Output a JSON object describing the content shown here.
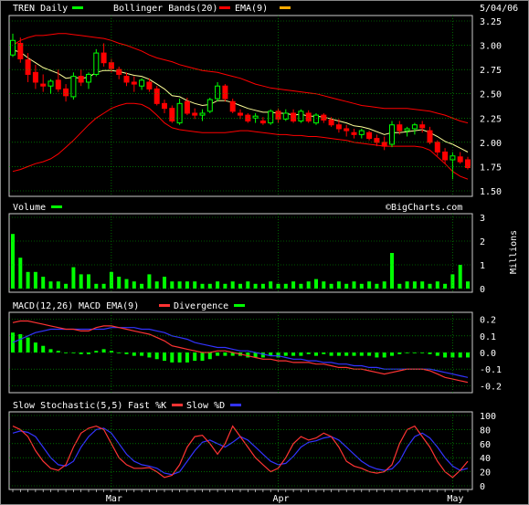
{
  "chart_data": {
    "type": "candlestick",
    "symbol_label": "TREN Daily",
    "date_label": "5/04/06",
    "watermark": "©BigCharts.com",
    "x_labels": [
      "Mar",
      "Apr",
      "May"
    ],
    "colors": {
      "up": "#00ff00",
      "down": "#ff0000",
      "ema": "#ffff99",
      "bollinger": "#ff0000",
      "grid": "#00aa00",
      "macd": "#ff3333",
      "signal": "#3333ff",
      "divergence": "#00ff00",
      "slow_k": "#ff3333",
      "slow_d": "#3333ff"
    },
    "price_panel": {
      "legend": [
        "TREN Daily",
        "Bollinger Bands(20)",
        "EMA(9)"
      ],
      "y_ticks": [
        "3.25",
        "3.00",
        "2.75",
        "2.50",
        "2.25",
        "2.00",
        "1.75",
        "1.50"
      ],
      "ylim": [
        1.5,
        3.25
      ],
      "candles": [
        [
          2.9,
          3.12,
          2.88,
          3.05
        ],
        [
          3.02,
          3.08,
          2.82,
          2.86
        ],
        [
          2.85,
          2.92,
          2.62,
          2.7
        ],
        [
          2.72,
          2.8,
          2.55,
          2.62
        ],
        [
          2.6,
          2.7,
          2.52,
          2.58
        ],
        [
          2.58,
          2.65,
          2.5,
          2.63
        ],
        [
          2.64,
          2.75,
          2.52,
          2.55
        ],
        [
          2.55,
          2.6,
          2.42,
          2.48
        ],
        [
          2.47,
          2.72,
          2.44,
          2.68
        ],
        [
          2.68,
          2.75,
          2.58,
          2.62
        ],
        [
          2.62,
          2.72,
          2.55,
          2.7
        ],
        [
          2.7,
          2.96,
          2.68,
          2.92
        ],
        [
          2.92,
          3.02,
          2.78,
          2.82
        ],
        [
          2.82,
          2.86,
          2.72,
          2.76
        ],
        [
          2.75,
          2.78,
          2.65,
          2.7
        ],
        [
          2.68,
          2.72,
          2.58,
          2.62
        ],
        [
          2.62,
          2.68,
          2.52,
          2.6
        ],
        [
          2.58,
          2.66,
          2.54,
          2.64
        ],
        [
          2.62,
          2.66,
          2.52,
          2.55
        ],
        [
          2.55,
          2.58,
          2.38,
          2.4
        ],
        [
          2.4,
          2.44,
          2.3,
          2.35
        ],
        [
          2.35,
          2.38,
          2.2,
          2.22
        ],
        [
          2.2,
          2.45,
          2.18,
          2.4
        ],
        [
          2.42,
          2.46,
          2.28,
          2.3
        ],
        [
          2.3,
          2.35,
          2.24,
          2.28
        ],
        [
          2.28,
          2.34,
          2.22,
          2.3
        ],
        [
          2.32,
          2.46,
          2.3,
          2.44
        ],
        [
          2.45,
          2.62,
          2.42,
          2.58
        ],
        [
          2.58,
          2.6,
          2.42,
          2.45
        ],
        [
          2.42,
          2.45,
          2.3,
          2.32
        ],
        [
          2.3,
          2.34,
          2.24,
          2.28
        ],
        [
          2.28,
          2.3,
          2.2,
          2.22
        ],
        [
          2.25,
          2.3,
          2.2,
          2.27
        ],
        [
          2.22,
          2.26,
          2.18,
          2.2
        ],
        [
          2.2,
          2.34,
          2.18,
          2.32
        ],
        [
          2.32,
          2.35,
          2.2,
          2.24
        ],
        [
          2.24,
          2.34,
          2.22,
          2.3
        ],
        [
          2.3,
          2.34,
          2.2,
          2.22
        ],
        [
          2.22,
          2.34,
          2.2,
          2.32
        ],
        [
          2.3,
          2.33,
          2.2,
          2.22
        ],
        [
          2.2,
          2.3,
          2.18,
          2.28
        ],
        [
          2.28,
          2.3,
          2.2,
          2.23
        ],
        [
          2.23,
          2.26,
          2.16,
          2.18
        ],
        [
          2.18,
          2.24,
          2.1,
          2.14
        ],
        [
          2.14,
          2.18,
          2.06,
          2.12
        ],
        [
          2.1,
          2.14,
          2.04,
          2.08
        ],
        [
          2.08,
          2.14,
          2.04,
          2.12
        ],
        [
          2.1,
          2.12,
          2.02,
          2.04
        ],
        [
          2.04,
          2.08,
          1.96,
          2.0
        ],
        [
          2.0,
          2.06,
          1.92,
          1.96
        ],
        [
          1.98,
          2.22,
          1.95,
          2.18
        ],
        [
          2.18,
          2.22,
          2.08,
          2.12
        ],
        [
          2.12,
          2.16,
          2.06,
          2.14
        ],
        [
          2.14,
          2.2,
          2.08,
          2.18
        ],
        [
          2.18,
          2.22,
          2.1,
          2.15
        ],
        [
          2.12,
          2.16,
          1.98,
          2.0
        ],
        [
          2.0,
          2.02,
          1.86,
          1.9
        ],
        [
          1.9,
          1.94,
          1.78,
          1.82
        ],
        [
          1.82,
          1.9,
          1.62,
          1.86
        ],
        [
          1.85,
          1.9,
          1.78,
          1.8
        ],
        [
          1.82,
          1.85,
          1.72,
          1.74
        ]
      ],
      "ema": [
        2.95,
        2.93,
        2.87,
        2.82,
        2.77,
        2.74,
        2.71,
        2.66,
        2.67,
        2.66,
        2.67,
        2.72,
        2.74,
        2.74,
        2.73,
        2.71,
        2.69,
        2.68,
        2.65,
        2.6,
        2.55,
        2.48,
        2.47,
        2.43,
        2.4,
        2.38,
        2.39,
        2.43,
        2.43,
        2.41,
        2.38,
        2.35,
        2.33,
        2.31,
        2.31,
        2.3,
        2.3,
        2.28,
        2.29,
        2.27,
        2.27,
        2.26,
        2.24,
        2.22,
        2.2,
        2.17,
        2.16,
        2.14,
        2.11,
        2.08,
        2.1,
        2.1,
        2.11,
        2.12,
        2.13,
        2.1,
        2.06,
        2.01,
        1.98,
        1.94,
        1.9
      ],
      "bb_upper": [
        3.0,
        3.05,
        3.08,
        3.1,
        3.1,
        3.11,
        3.12,
        3.12,
        3.11,
        3.1,
        3.09,
        3.08,
        3.07,
        3.05,
        3.02,
        3.0,
        2.97,
        2.94,
        2.9,
        2.87,
        2.85,
        2.83,
        2.8,
        2.78,
        2.76,
        2.74,
        2.73,
        2.72,
        2.7,
        2.68,
        2.66,
        2.63,
        2.6,
        2.58,
        2.56,
        2.55,
        2.54,
        2.53,
        2.52,
        2.51,
        2.5,
        2.48,
        2.46,
        2.44,
        2.42,
        2.4,
        2.38,
        2.37,
        2.36,
        2.35,
        2.35,
        2.35,
        2.35,
        2.34,
        2.33,
        2.32,
        2.3,
        2.28,
        2.25,
        2.22,
        2.2
      ],
      "bb_lower": [
        1.7,
        1.72,
        1.75,
        1.78,
        1.8,
        1.83,
        1.88,
        1.95,
        2.02,
        2.1,
        2.18,
        2.25,
        2.3,
        2.35,
        2.38,
        2.4,
        2.4,
        2.39,
        2.35,
        2.28,
        2.2,
        2.15,
        2.13,
        2.12,
        2.11,
        2.1,
        2.1,
        2.1,
        2.1,
        2.11,
        2.12,
        2.12,
        2.11,
        2.1,
        2.09,
        2.08,
        2.08,
        2.07,
        2.07,
        2.06,
        2.06,
        2.05,
        2.04,
        2.03,
        2.02,
        2.0,
        1.99,
        1.98,
        1.97,
        1.96,
        1.96,
        1.96,
        1.96,
        1.96,
        1.95,
        1.92,
        1.85,
        1.78,
        1.7,
        1.65,
        1.62
      ]
    },
    "volume_panel": {
      "legend": [
        "Volume"
      ],
      "y_ticks": [
        "3",
        "2",
        "1",
        "0"
      ],
      "ylim": [
        0,
        3
      ],
      "unit_label": "Millions",
      "values": [
        2.3,
        1.3,
        0.7,
        0.7,
        0.5,
        0.3,
        0.3,
        0.2,
        0.9,
        0.6,
        0.6,
        0.2,
        0.2,
        0.7,
        0.5,
        0.4,
        0.3,
        0.2,
        0.6,
        0.3,
        0.5,
        0.3,
        0.3,
        0.3,
        0.3,
        0.2,
        0.2,
        0.3,
        0.2,
        0.3,
        0.2,
        0.3,
        0.2,
        0.2,
        0.3,
        0.2,
        0.2,
        0.3,
        0.2,
        0.3,
        0.4,
        0.3,
        0.2,
        0.3,
        0.2,
        0.3,
        0.2,
        0.3,
        0.2,
        0.3,
        1.5,
        0.2,
        0.3,
        0.3,
        0.3,
        0.2,
        0.3,
        0.2,
        0.6,
        1.0,
        0.3
      ]
    },
    "macd_panel": {
      "legend": [
        "MACD(12,26)",
        "MACD EMA(9)",
        "Divergence"
      ],
      "y_ticks": [
        "0.2",
        "0.1",
        "0.0",
        "-0.1",
        "-0.2"
      ],
      "ylim": [
        -0.22,
        0.22
      ],
      "macd": [
        0.18,
        0.19,
        0.19,
        0.18,
        0.17,
        0.16,
        0.15,
        0.14,
        0.14,
        0.13,
        0.13,
        0.15,
        0.16,
        0.16,
        0.15,
        0.14,
        0.13,
        0.12,
        0.11,
        0.09,
        0.07,
        0.04,
        0.03,
        0.02,
        0.01,
        0.0,
        0.0,
        0.01,
        0.01,
        0.0,
        -0.01,
        -0.02,
        -0.03,
        -0.04,
        -0.04,
        -0.05,
        -0.05,
        -0.06,
        -0.06,
        -0.06,
        -0.07,
        -0.07,
        -0.08,
        -0.09,
        -0.09,
        -0.1,
        -0.1,
        -0.11,
        -0.12,
        -0.13,
        -0.12,
        -0.11,
        -0.1,
        -0.1,
        -0.1,
        -0.11,
        -0.13,
        -0.15,
        -0.16,
        -0.17,
        -0.18
      ],
      "signal": [
        0.06,
        0.08,
        0.1,
        0.12,
        0.13,
        0.14,
        0.14,
        0.14,
        0.14,
        0.14,
        0.14,
        0.14,
        0.14,
        0.15,
        0.15,
        0.15,
        0.15,
        0.14,
        0.14,
        0.13,
        0.12,
        0.1,
        0.09,
        0.08,
        0.06,
        0.05,
        0.04,
        0.03,
        0.03,
        0.02,
        0.01,
        0.01,
        0.0,
        -0.01,
        -0.02,
        -0.02,
        -0.03,
        -0.04,
        -0.04,
        -0.05,
        -0.05,
        -0.06,
        -0.06,
        -0.07,
        -0.07,
        -0.08,
        -0.08,
        -0.09,
        -0.09,
        -0.1,
        -0.1,
        -0.1,
        -0.1,
        -0.1,
        -0.1,
        -0.1,
        -0.11,
        -0.12,
        -0.13,
        -0.14,
        -0.15
      ],
      "divergence": [
        0.12,
        0.11,
        0.09,
        0.06,
        0.04,
        0.02,
        0.01,
        0.0,
        0.0,
        -0.01,
        -0.01,
        0.01,
        0.02,
        0.01,
        0.0,
        -0.01,
        -0.02,
        -0.02,
        -0.03,
        -0.04,
        -0.05,
        -0.06,
        -0.06,
        -0.06,
        -0.05,
        -0.05,
        -0.04,
        -0.02,
        -0.02,
        -0.02,
        -0.02,
        -0.03,
        -0.03,
        -0.03,
        -0.02,
        -0.03,
        -0.02,
        -0.02,
        -0.02,
        -0.01,
        -0.02,
        -0.01,
        -0.02,
        -0.02,
        -0.02,
        -0.02,
        -0.02,
        -0.02,
        -0.03,
        -0.03,
        -0.02,
        -0.01,
        0.0,
        0.0,
        0.0,
        -0.01,
        -0.02,
        -0.03,
        -0.03,
        -0.03,
        -0.03
      ]
    },
    "stoch_panel": {
      "legend": [
        "Slow Stochastic(5,5)",
        "Fast %K",
        "Slow %D"
      ],
      "y_ticks": [
        "100",
        "80",
        "60",
        "40",
        "20",
        "0"
      ],
      "ylim": [
        0,
        100
      ],
      "slow_k": [
        85,
        80,
        70,
        50,
        35,
        25,
        22,
        30,
        55,
        75,
        82,
        85,
        80,
        60,
        40,
        30,
        25,
        25,
        26,
        20,
        12,
        15,
        30,
        55,
        70,
        72,
        60,
        45,
        60,
        85,
        70,
        55,
        40,
        30,
        20,
        25,
        40,
        60,
        70,
        65,
        68,
        75,
        70,
        55,
        35,
        28,
        25,
        20,
        18,
        20,
        30,
        60,
        80,
        85,
        70,
        55,
        35,
        20,
        12,
        22,
        35
      ],
      "slow_d": [
        75,
        78,
        76,
        70,
        55,
        40,
        30,
        28,
        35,
        55,
        70,
        80,
        82,
        75,
        60,
        45,
        35,
        30,
        28,
        25,
        18,
        16,
        20,
        35,
        50,
        62,
        65,
        60,
        55,
        62,
        70,
        65,
        55,
        45,
        35,
        30,
        32,
        42,
        55,
        62,
        64,
        68,
        70,
        65,
        55,
        45,
        35,
        28,
        24,
        22,
        24,
        35,
        55,
        70,
        75,
        68,
        55,
        40,
        28,
        22,
        25
      ]
    }
  }
}
